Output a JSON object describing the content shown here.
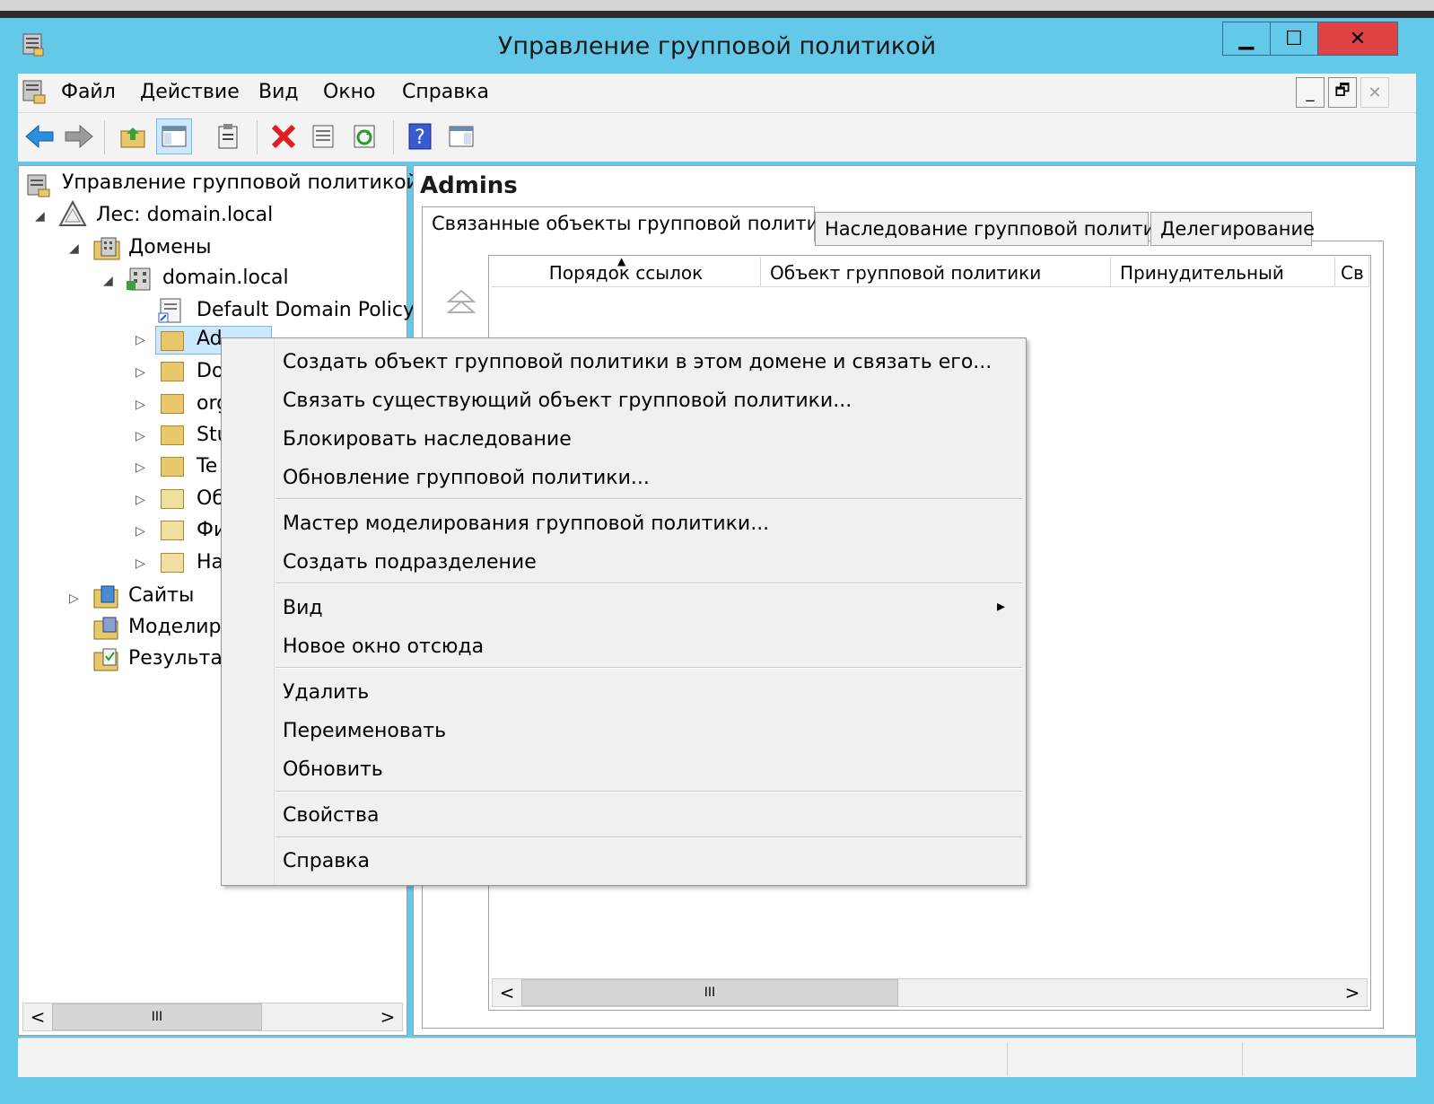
{
  "window": {
    "title": "Управление групповой политикой"
  },
  "caption_buttons": {
    "minimize": "▁",
    "maximize": "☐",
    "close": "✕"
  },
  "menubar": {
    "items": [
      "Файл",
      "Действие",
      "Вид",
      "Окно",
      "Справка"
    ]
  },
  "mdi_buttons": {
    "minimize": "_",
    "restore": "🗗",
    "close": "✕"
  },
  "tree": {
    "root": "Управление групповой политикой",
    "forest": "Лес: domain.local",
    "domains": "Домены",
    "domain": "domain.local",
    "default_policy": "Default Domain Policy",
    "ous": [
      "Ad",
      "Do",
      "org",
      "Stu",
      "Te",
      "Об",
      "Фи",
      "На"
    ],
    "sites": "Сайты",
    "modeling": "Моделир",
    "results": "Результат"
  },
  "right": {
    "heading": "Admins",
    "tabs": [
      "Связанные объекты групповой политики",
      "Наследование групповой политики",
      "Делегирование"
    ],
    "columns": [
      "Порядок ссылок",
      "Объект групповой политики",
      "Принудительный",
      "Св"
    ]
  },
  "scrollbar": {
    "grip": "III",
    "left": "<",
    "right": ">"
  },
  "context_menu": {
    "items": [
      "Создать объект групповой политики в этом домене и связать его...",
      "Связать существующий объект групповой политики...",
      "Блокировать наследование",
      "Обновление групповой политики...",
      "Мастер моделирования групповой политики...",
      "Создать подразделение",
      "Вид",
      "Новое окно отсюда",
      "Удалить",
      "Переименовать",
      "Обновить",
      "Свойства",
      "Справка"
    ],
    "submenu_arrow": "▸"
  },
  "colors": {
    "titlebar": "#64c8e8",
    "close_button": "#e04343",
    "selection": "#cce8ff"
  }
}
